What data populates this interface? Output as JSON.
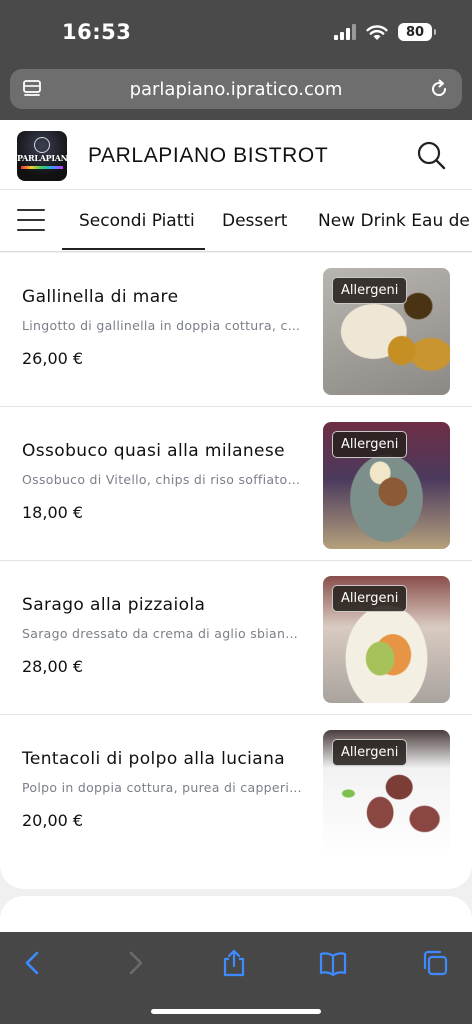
{
  "status_bar": {
    "time": "16:53",
    "battery": "80",
    "icons": [
      "cellular-signal-icon",
      "wifi-icon",
      "battery-icon"
    ]
  },
  "browser": {
    "url": "parlapiano.ipratico.com",
    "icons": [
      "reader-mode-icon",
      "reload-icon"
    ]
  },
  "header": {
    "logo_text": "PARLAPIANO",
    "title": "PARLAPIANO BISTROT",
    "search_icon": "search-icon"
  },
  "tabs": {
    "menu_icon": "hamburger-menu-icon",
    "items": [
      {
        "label": "Secondi Piatti",
        "active": true
      },
      {
        "label": "Dessert",
        "active": false
      },
      {
        "label": "New Drink Eau de Pa",
        "active": false
      }
    ]
  },
  "menu_items": [
    {
      "name": "Gallinella di mare",
      "description": "Lingotto di gallinella in doppia cottura, chips di riso",
      "price": "26,00 €",
      "badge": "Allergeni"
    },
    {
      "name": "Ossobuco quasi alla milanese",
      "description": "Ossobuco di Vitello, chips di riso soffiato allo zafferano",
      "price": "18,00 €",
      "badge": "Allergeni"
    },
    {
      "name": "Sarago alla pizzaiola",
      "description": "Sarago dressato da crema di aglio sbiancato",
      "price": "28,00 €",
      "badge": "Allergeni"
    },
    {
      "name": "Tentacoli di polpo alla luciana",
      "description": "Polpo in doppia cottura, purea di capperi, pomodoro",
      "price": "20,00 €",
      "badge": "Allergeni"
    }
  ],
  "toolbar": {
    "icons": [
      "back-icon",
      "forward-icon",
      "share-icon",
      "bookmarks-icon",
      "tabs-icon"
    ],
    "accent": "#3d8bff"
  }
}
